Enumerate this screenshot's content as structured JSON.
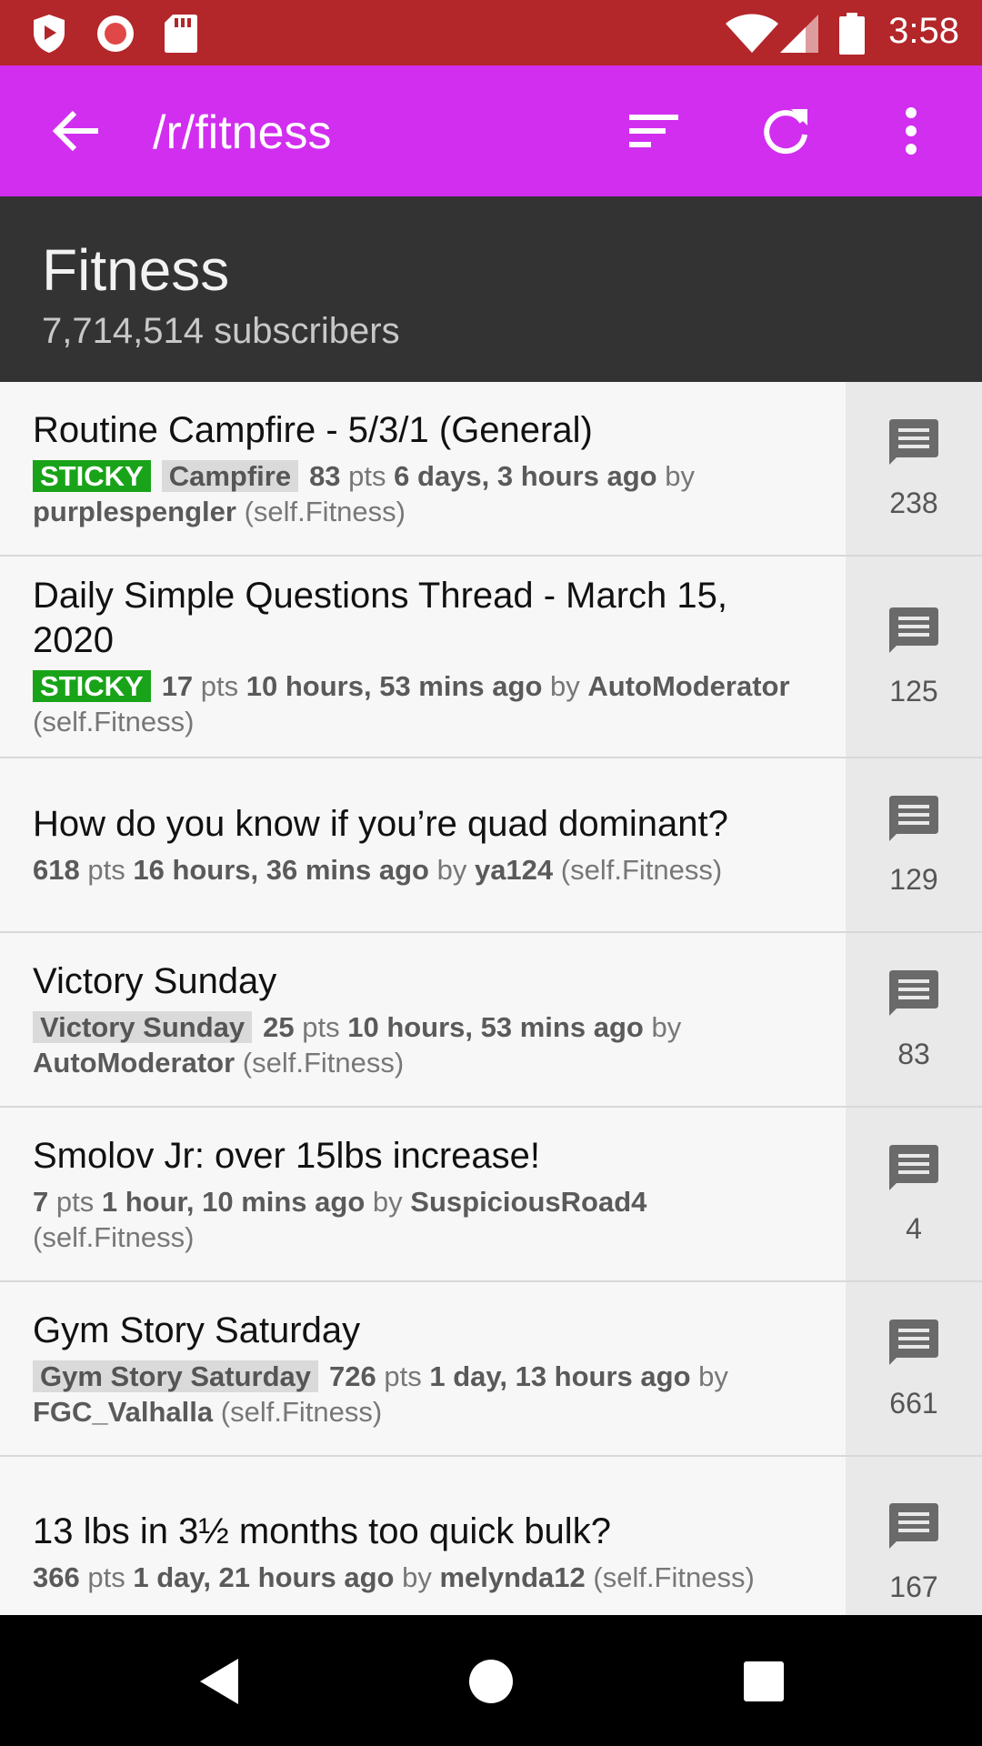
{
  "status_bar": {
    "time": "3:58"
  },
  "app_bar": {
    "title": "/r/fitness"
  },
  "subreddit": {
    "name": "Fitness",
    "subscribers": "7,714,514 subscribers"
  },
  "posts": [
    {
      "title": "Routine Campfire - 5/3/1 (General)",
      "sticky": "STICKY",
      "flair": "Campfire",
      "points": "83",
      "pts_label": "pts",
      "age": "6 days, 3 hours ago",
      "by_label": "by",
      "author": "purplespengler",
      "domain": "(self.Fitness)",
      "comments": "238"
    },
    {
      "title": "Daily Simple Questions Thread - March 15, 2020",
      "sticky": "STICKY",
      "flair": "",
      "points": "17",
      "pts_label": "pts",
      "age": "10 hours, 53 mins ago",
      "by_label": "by",
      "author": "AutoModerator",
      "domain": "(self.Fitness)",
      "comments": "125"
    },
    {
      "title": "How do you know if you’re quad dominant?",
      "sticky": "",
      "flair": "",
      "points": "618",
      "pts_label": "pts",
      "age": "16 hours, 36 mins ago",
      "by_label": "by",
      "author": "ya124",
      "domain": "(self.Fitness)",
      "comments": "129"
    },
    {
      "title": "Victory Sunday",
      "sticky": "",
      "flair": "Victory Sunday",
      "points": "25",
      "pts_label": "pts",
      "age": "10 hours, 53 mins ago",
      "by_label": "by",
      "author": "AutoModerator",
      "domain": "(self.Fitness)",
      "comments": "83"
    },
    {
      "title": "Smolov Jr: over 15lbs increase!",
      "sticky": "",
      "flair": "",
      "points": "7",
      "pts_label": "pts",
      "age": "1 hour, 10 mins ago",
      "by_label": "by",
      "author": "SuspiciousRoad4",
      "domain": "(self.Fitness)",
      "comments": "4"
    },
    {
      "title": "Gym Story Saturday",
      "sticky": "",
      "flair": "Gym Story Saturday",
      "points": "726",
      "pts_label": "pts",
      "age": "1 day, 13 hours ago",
      "by_label": "by",
      "author": "FGC_Valhalla",
      "domain": "(self.Fitness)",
      "comments": "661"
    },
    {
      "title": "13 lbs in 3½ months too quick bulk?",
      "sticky": "",
      "flair": "",
      "points": "366",
      "pts_label": "pts",
      "age": "1 day, 21 hours ago",
      "by_label": "by",
      "author": "melynda12",
      "domain": "(self.Fitness)",
      "comments": "167"
    }
  ],
  "colors": {
    "status_bar": "#b3262a",
    "app_bar": "#d12ef0",
    "header": "#333333",
    "sticky": "#19a319"
  }
}
